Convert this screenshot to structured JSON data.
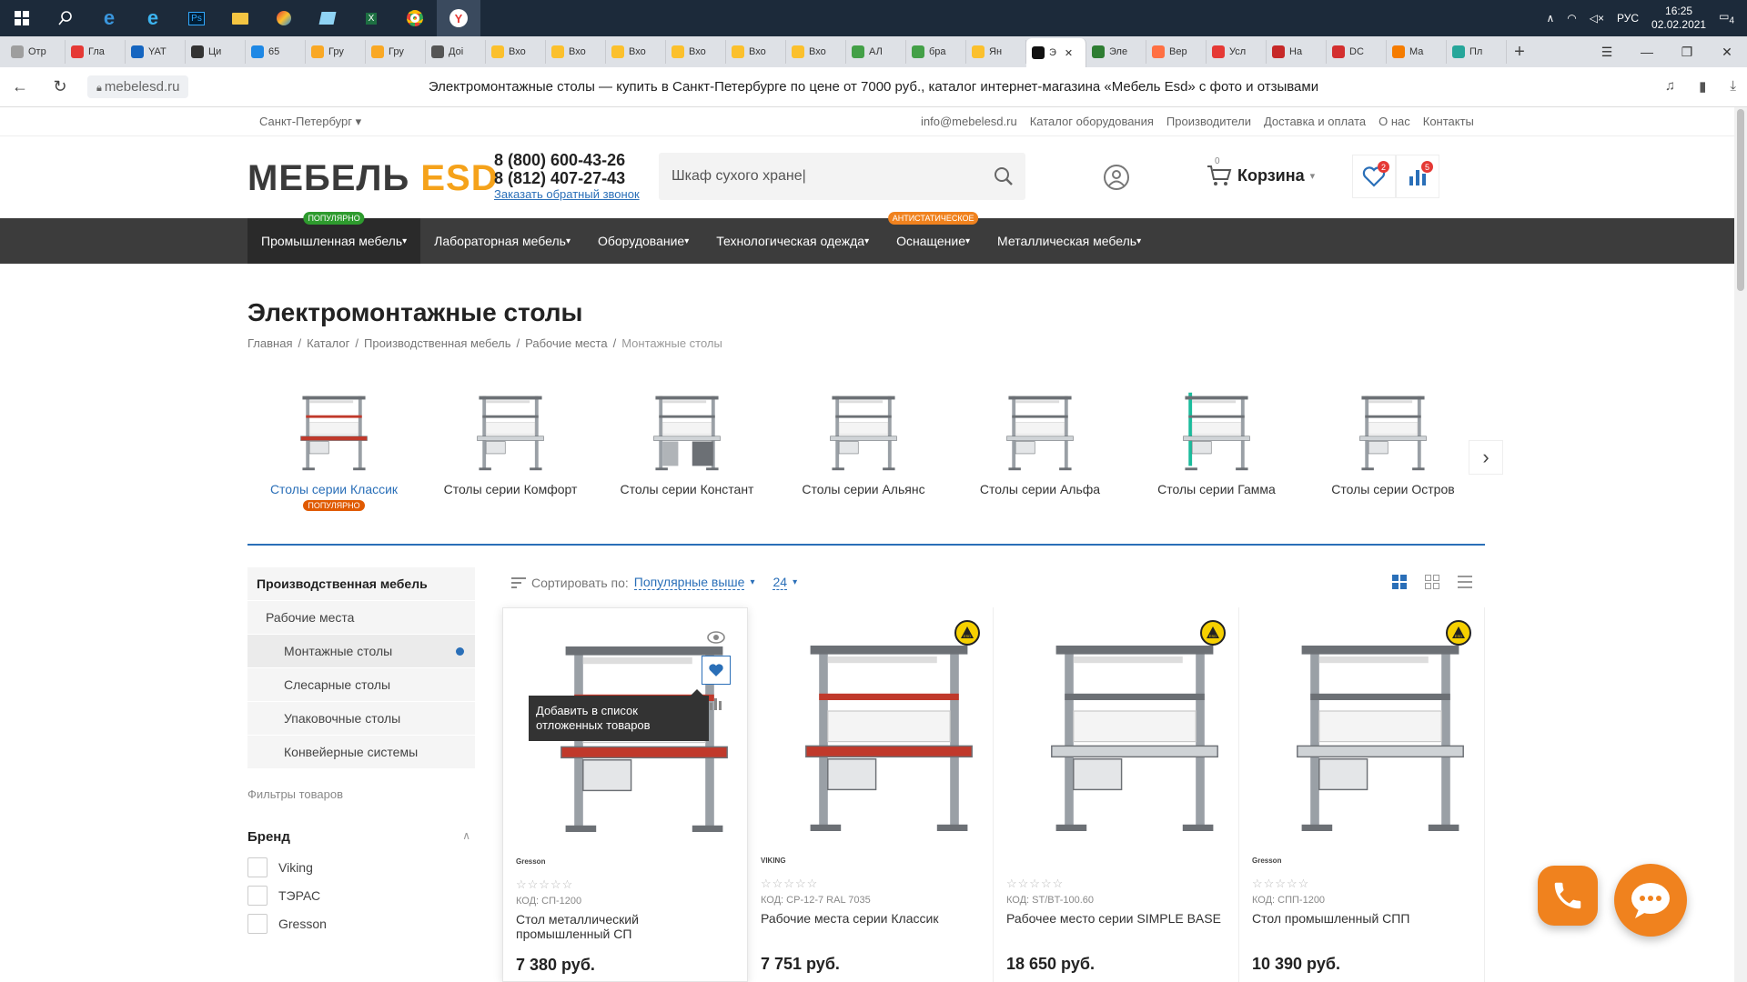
{
  "os": {
    "lang": "РУС",
    "time": "16:25",
    "date": "02.02.2021",
    "notif": "4"
  },
  "tabs": [
    {
      "label": "Отр",
      "color": "#9e9e9e"
    },
    {
      "label": "Гла",
      "color": "#e53935"
    },
    {
      "label": "YAT",
      "color": "#1565c0"
    },
    {
      "label": "Ци",
      "color": "#333333"
    },
    {
      "label": "65",
      "color": "#1e88e5"
    },
    {
      "label": "Гру",
      "color": "#f9a825"
    },
    {
      "label": "Гру",
      "color": "#f9a825"
    },
    {
      "label": "Доі",
      "color": "#555555"
    },
    {
      "label": "Вхо",
      "color": "#fbc02d"
    },
    {
      "label": "Вхо",
      "color": "#fbc02d"
    },
    {
      "label": "Вхо",
      "color": "#fbc02d"
    },
    {
      "label": "Вхо",
      "color": "#fbc02d"
    },
    {
      "label": "Вхо",
      "color": "#fbc02d"
    },
    {
      "label": "Вхо",
      "color": "#fbc02d"
    },
    {
      "label": "АЛ",
      "color": "#43a047"
    },
    {
      "label": "бра",
      "color": "#43a047"
    },
    {
      "label": "Ян",
      "color": "#fbc02d"
    },
    {
      "label": "Э",
      "color": "#111111"
    },
    {
      "label": "Эле",
      "color": "#2e7d32"
    },
    {
      "label": "Вер",
      "color": "#ff7043"
    },
    {
      "label": "Усл",
      "color": "#e53935"
    },
    {
      "label": "На",
      "color": "#c62828"
    },
    {
      "label": "DC",
      "color": "#d32f2f"
    },
    {
      "label": "Ма",
      "color": "#f57c00"
    },
    {
      "label": "Пл",
      "color": "#26a69a"
    }
  ],
  "browser": {
    "url": "mebelesd.ru",
    "title": "Электромонтажные столы — купить в Санкт-Петербурге по цене от 7000 руб., каталог интернет-магазина «Мебель Esd» с фото и отзывами"
  },
  "toplinks": {
    "city": "Санкт-Петербург",
    "links": [
      "info@mebelesd.ru",
      "Каталог оборудования",
      "Производители",
      "Доставка и оплата",
      "О нас",
      "Контакты"
    ]
  },
  "header": {
    "logo_main": "МЕБЕЛЬ",
    "logo_accent": "ESD",
    "phone1": "8 (800) 600-43-26",
    "phone2": "8 (812) 407-27-43",
    "callback": "Заказать обратный звонок",
    "search_value": "Шкаф сухого хране|",
    "cart_label": "Корзина",
    "cart_count": "0",
    "fav_count": "2",
    "compare_count": "5"
  },
  "menu": [
    {
      "label": "Промышленная мебель",
      "badge": "ПОПУЛЯРНО",
      "badge_color": "#2e9b2e"
    },
    {
      "label": "Лабораторная мебель",
      "badge": "",
      "badge_color": ""
    },
    {
      "label": "Оборудование",
      "badge": "",
      "badge_color": ""
    },
    {
      "label": "Технологическая одежда",
      "badge": "",
      "badge_color": ""
    },
    {
      "label": "Оснащение",
      "badge": "АНТИСТАТИЧЕСКОЕ",
      "badge_color": "#f0821e"
    },
    {
      "label": "Металлическая мебель",
      "badge": "",
      "badge_color": ""
    }
  ],
  "page": {
    "title": "Электромонтажные столы",
    "breadcrumbs": [
      "Главная",
      "Каталог",
      "Производственная мебель",
      "Рабочие места",
      "Монтажные столы"
    ]
  },
  "carousel": [
    {
      "label": "Столы серии Классик",
      "badge": "ПОПУЛЯРНО"
    },
    {
      "label": "Столы серии Комфорт",
      "badge": ""
    },
    {
      "label": "Столы серии Констант",
      "badge": ""
    },
    {
      "label": "Столы серии Альянс",
      "badge": ""
    },
    {
      "label": "Столы серии Альфа",
      "badge": ""
    },
    {
      "label": "Столы серии Гамма",
      "badge": ""
    },
    {
      "label": "Столы серии Остров",
      "badge": ""
    }
  ],
  "sidebar": {
    "items": [
      "Производственная мебель",
      "Рабочие места",
      "Монтажные столы",
      "Слесарные столы",
      "Упаковочные столы",
      "Конвейерные системы"
    ],
    "filters_title": "Фильтры товаров",
    "brand_title": "Бренд",
    "brands": [
      "Viking",
      "ТЭРАС",
      "Gresson"
    ]
  },
  "sort": {
    "label": "Сортировать по:",
    "value": "Популярные выше",
    "per_page": "24"
  },
  "tooltip": "Добавить в список отложенных товаров",
  "products": [
    {
      "maker": "Gresson",
      "stars": "☆☆☆☆☆",
      "code": "КОД:  СП-1200",
      "name": "Стол металлический промышленный СП",
      "price": "7 380 руб."
    },
    {
      "maker": "VIKING",
      "stars": "☆☆☆☆☆",
      "code": "КОД:  СР-12-7 RAL 7035",
      "name": "Рабочие места серии Классик",
      "price": "7 751 руб."
    },
    {
      "maker": "",
      "stars": "☆☆☆☆☆",
      "code": "КОД:  ST/BT-100.60",
      "name": "Рабочее место серии SIMPLE BASE",
      "price": "18 650 руб."
    },
    {
      "maker": "Gresson",
      "stars": "☆☆☆☆☆",
      "code": "КОД:  СПП-1200",
      "name": "Стол промышленный СПП",
      "price": "10 390 руб."
    }
  ],
  "colors": {
    "accent": "#2a6fb8",
    "logo": "#f5a21a",
    "menu_bg": "#3c3c3c",
    "fab": "#f0821e"
  }
}
